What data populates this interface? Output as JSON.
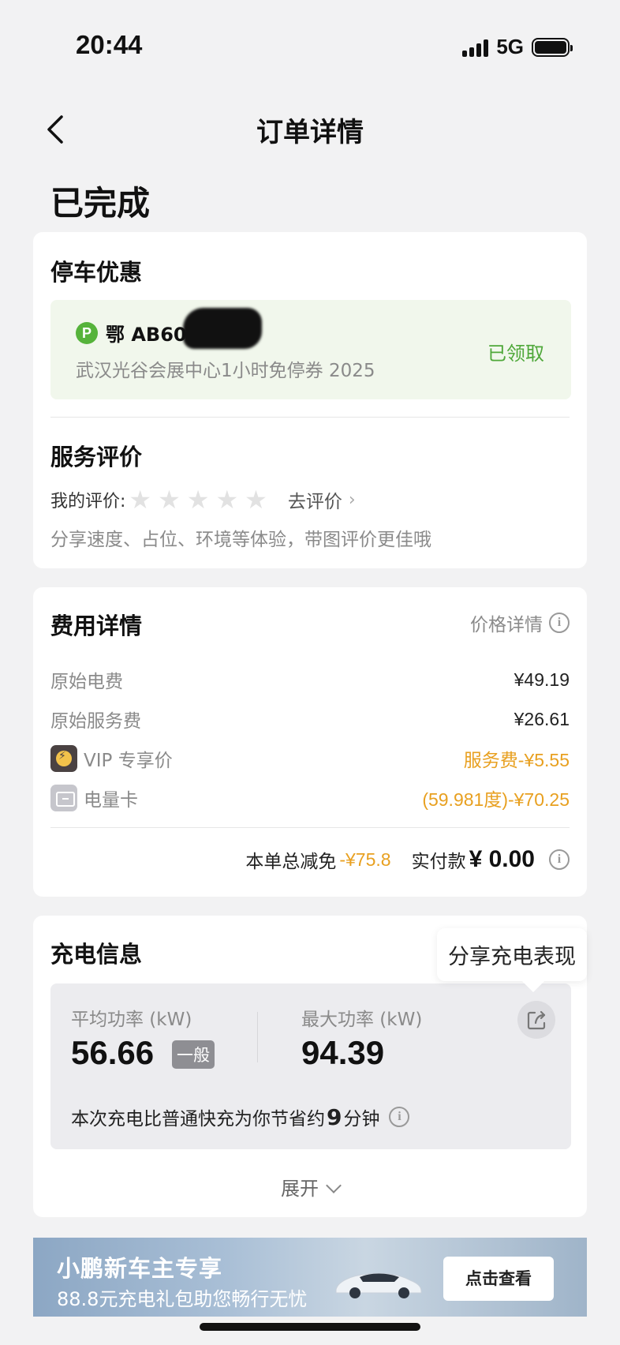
{
  "status_bar": {
    "time": "20:44",
    "network": "5G"
  },
  "nav": {
    "title": "订单详情"
  },
  "order_status": "已完成",
  "parking": {
    "title": "停车优惠",
    "plate": "鄂 AB60",
    "coupon_desc": "武汉光谷会展中心1小时免停券 2025",
    "status": "已领取"
  },
  "review": {
    "title": "服务评价",
    "label": "我的评价:",
    "stars": [
      "★",
      "★",
      "★",
      "★",
      "★"
    ],
    "go_rate": "去评价",
    "hint": "分享速度、占位、环境等体验，带图评价更佳哦"
  },
  "fees": {
    "title": "费用详情",
    "price_detail_link": "价格详情",
    "rows": [
      {
        "label": "原始电费",
        "value": "¥49.19",
        "highlight": false
      },
      {
        "label": "原始服务费",
        "value": "¥26.61",
        "highlight": false
      },
      {
        "label": "VIP 专享价",
        "value": "服务费-¥5.55",
        "highlight": true,
        "icon": "vip-icon"
      },
      {
        "label": "电量卡",
        "value": "(59.981度)-¥70.25",
        "highlight": true,
        "icon": "card-icon"
      }
    ],
    "total_discount_label": "本单总减免",
    "total_discount_value": "-¥75.8",
    "paid_label": "实付款",
    "paid_value": "¥ 0.00"
  },
  "charging": {
    "title": "充电信息",
    "share_tooltip": "分享充电表现",
    "avg_power_label": "平均功率 (kW)",
    "avg_power_value": "56.66",
    "avg_power_level": "一般",
    "max_power_label": "最大功率 (kW)",
    "max_power_value": "94.39",
    "save_prefix": "本次充电比普通快充为你节省约",
    "save_minutes": "9",
    "save_suffix": "分钟",
    "expand_label": "展开"
  },
  "banner": {
    "title": "小鹏新车主专享",
    "subtitle": "88.8元充电礼包助您畅行无忧",
    "button": "点击查看"
  },
  "colors": {
    "accent_green": "#4fa83a",
    "accent_orange": "#e8a020",
    "coupon_bg": "#f1f7ec"
  }
}
